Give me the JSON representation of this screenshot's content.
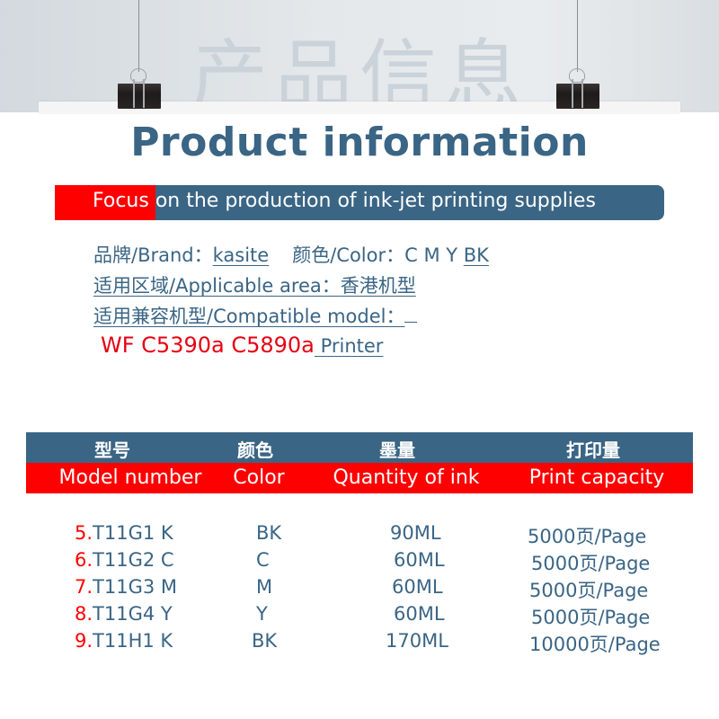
{
  "header": {
    "watermark": "产品信息",
    "title": "Product information",
    "tagline_highlight": "Focus",
    "tagline_rest": " on the production of ink-jet printing supplies"
  },
  "info": {
    "brand_label": "品牌/Brand：",
    "brand_value": "kasite",
    "color_label": "颜色/Color：",
    "color_value_plain": "C M Y ",
    "color_value_underlined": "BK",
    "area_label": "适用区域/Applicable area：",
    "area_value": "香港机型",
    "compatible_label": "适用兼容机型/Compatible model：",
    "compatible_models": "WF C5390a C5890a",
    "compatible_suffix": " Printer"
  },
  "table": {
    "headers_cn": [
      "型号",
      "颜色",
      "墨量",
      "打印量"
    ],
    "headers_en": [
      "Model number",
      "Color",
      "Quantity of ink",
      "Print capacity"
    ],
    "rows": [
      {
        "index": "5.",
        "model": "T11G1 K",
        "color": "BK",
        "ink": "90ML",
        "capacity": "5000页/Page"
      },
      {
        "index": "6.",
        "model": "T11G2 C",
        "color": "C",
        "ink": "60ML",
        "capacity": "5000页/Page"
      },
      {
        "index": "7.",
        "model": "T11G3 M",
        "color": "M",
        "ink": "60ML",
        "capacity": "5000页/Page"
      },
      {
        "index": "8.",
        "model": "T11G4 Y",
        "color": "Y",
        "ink": "60ML",
        "capacity": "5000页/Page"
      },
      {
        "index": "9.",
        "model": "T11H1 K",
        "color": "BK",
        "ink": "170ML",
        "capacity": "10000页/Page"
      }
    ]
  },
  "colors": {
    "brand_blue": "#3a6585",
    "accent_red": "#ff0000"
  }
}
